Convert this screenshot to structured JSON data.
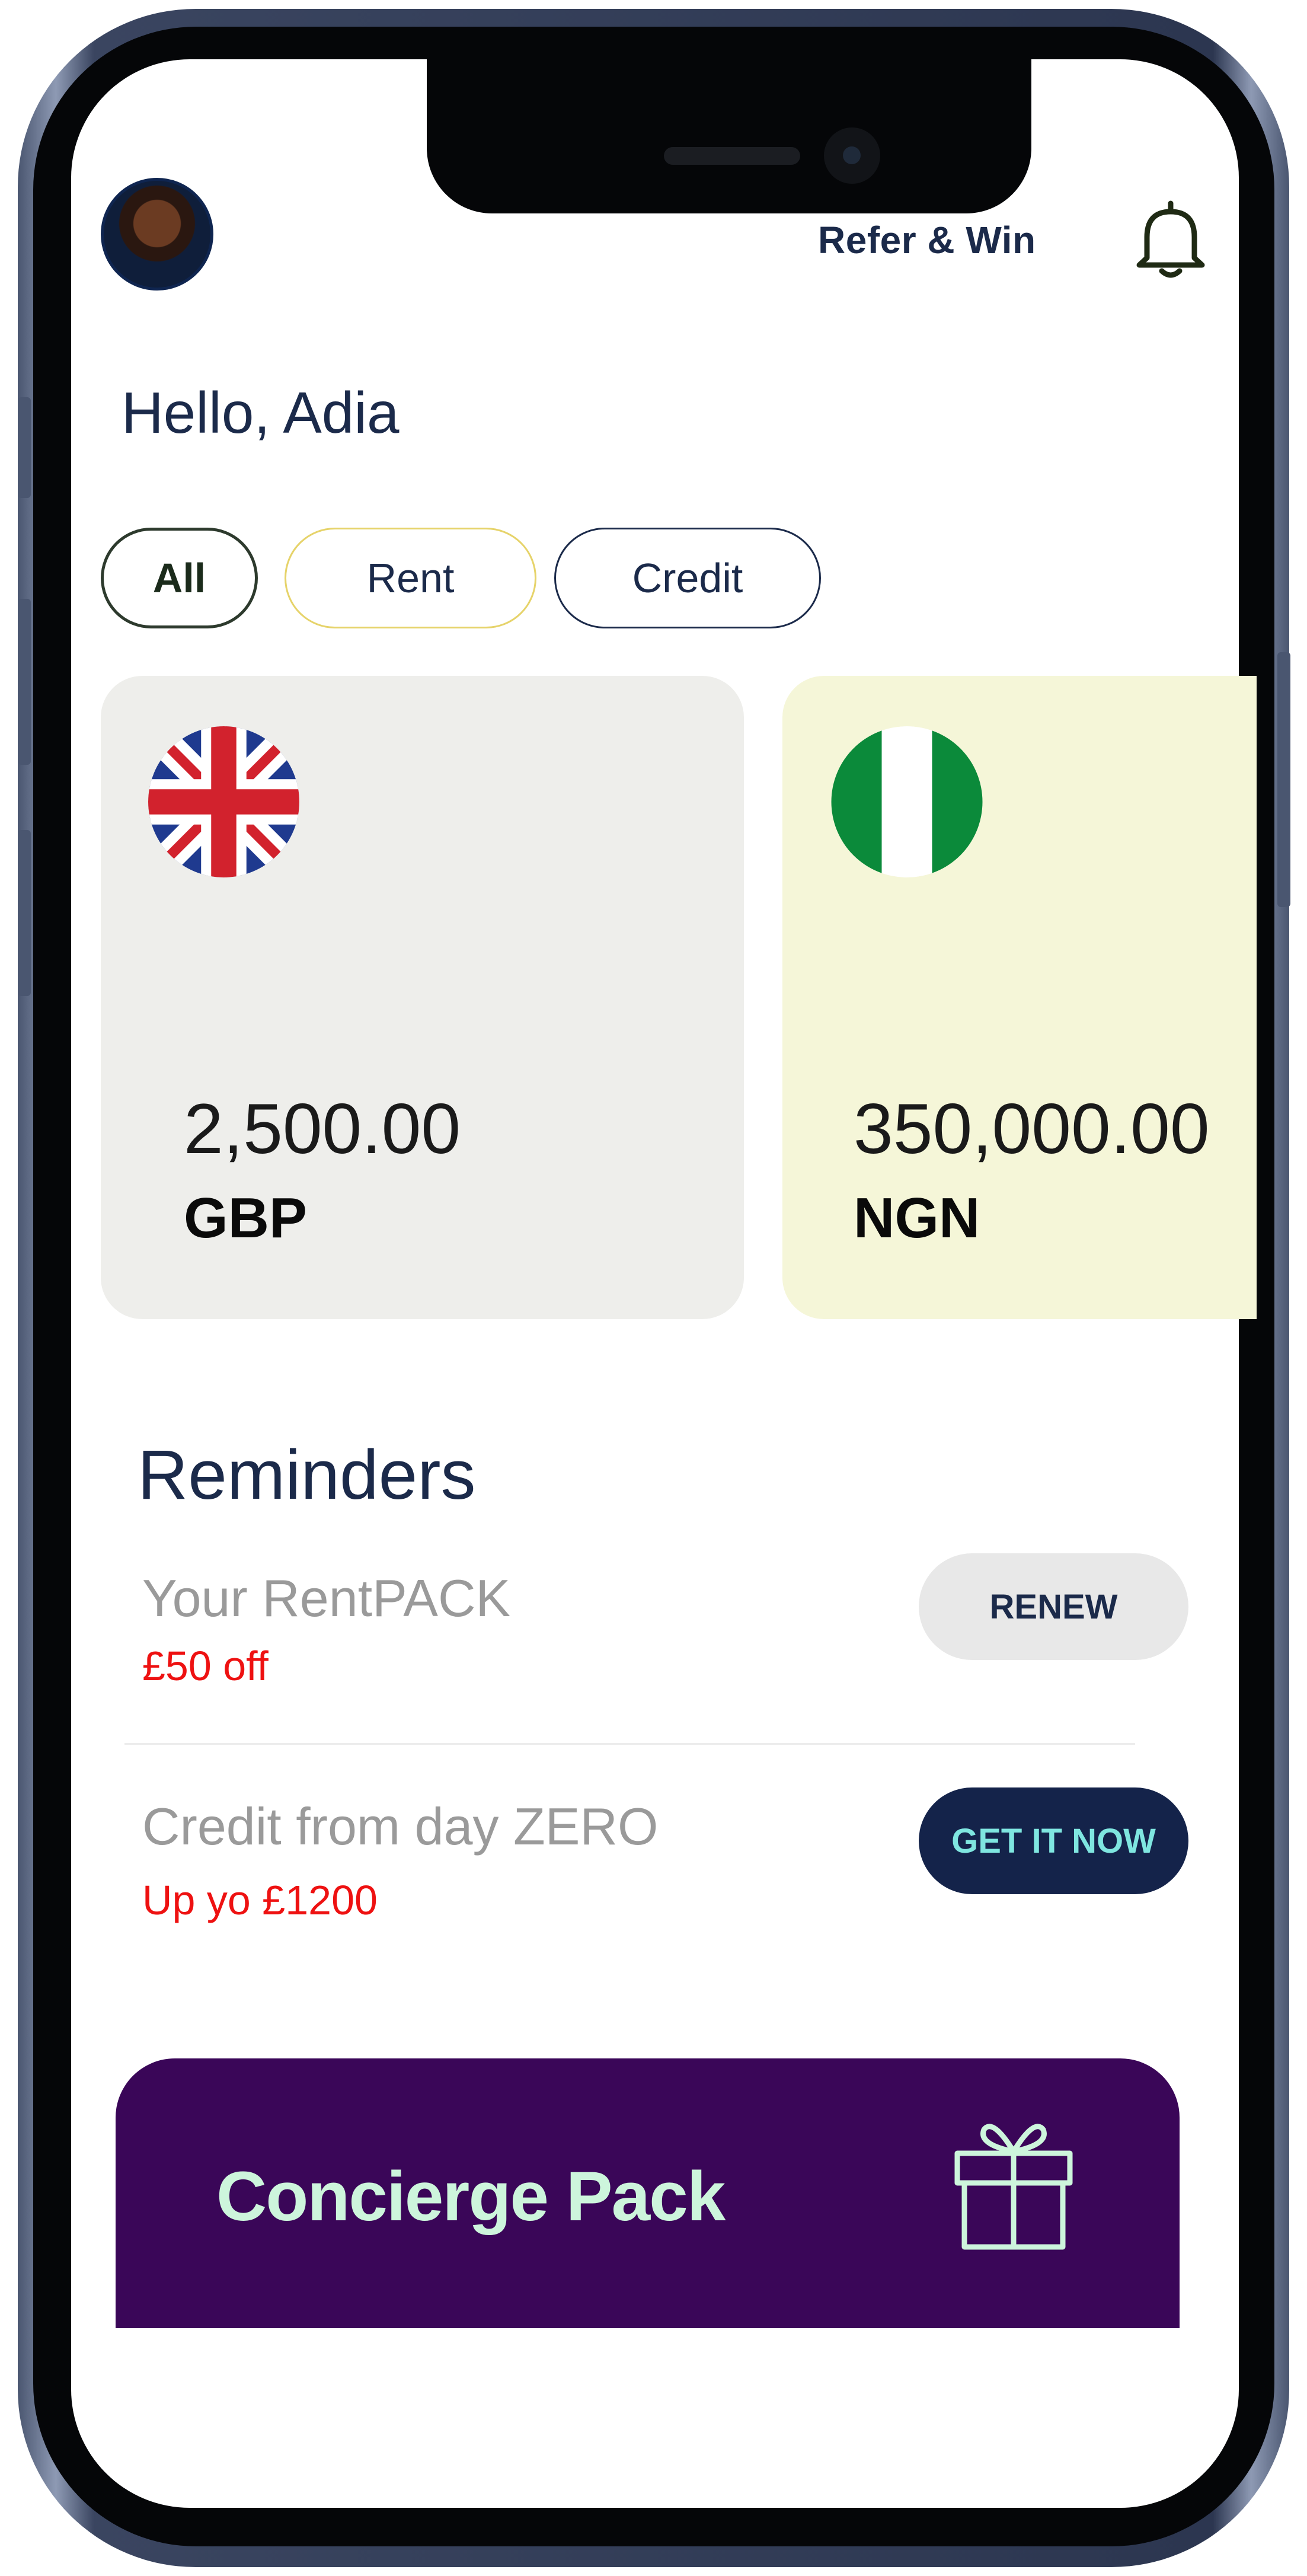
{
  "header": {
    "refer_label": "Refer & Win"
  },
  "greeting": "Hello, Adia",
  "filters": [
    {
      "label": "All",
      "selected": true
    },
    {
      "label": "Rent",
      "selected": false
    },
    {
      "label": "Credit",
      "selected": false
    }
  ],
  "wallets": [
    {
      "amount": "2,500.00",
      "currency": "GBP",
      "flag": "uk-flag-icon",
      "color": "#eeeeeb"
    },
    {
      "amount": "350,000.00",
      "currency": "NGN",
      "flag": "nigeria-flag-icon",
      "color": "#f5f6d8"
    }
  ],
  "reminders": {
    "title": "Reminders",
    "items": [
      {
        "text": "Your RentPACK",
        "subtext": "£50 off",
        "action": "RENEW"
      },
      {
        "text": "Credit from day ZERO",
        "subtext": "Up yo £1200",
        "action": "GET IT NOW"
      }
    ]
  },
  "concierge": {
    "label": "Concierge Pack",
    "icon": "gift-icon"
  },
  "colors": {
    "navy": "#1b2a4a",
    "purple": "#3a0658",
    "red": "#ee1111",
    "mint": "#cdf5dc"
  }
}
